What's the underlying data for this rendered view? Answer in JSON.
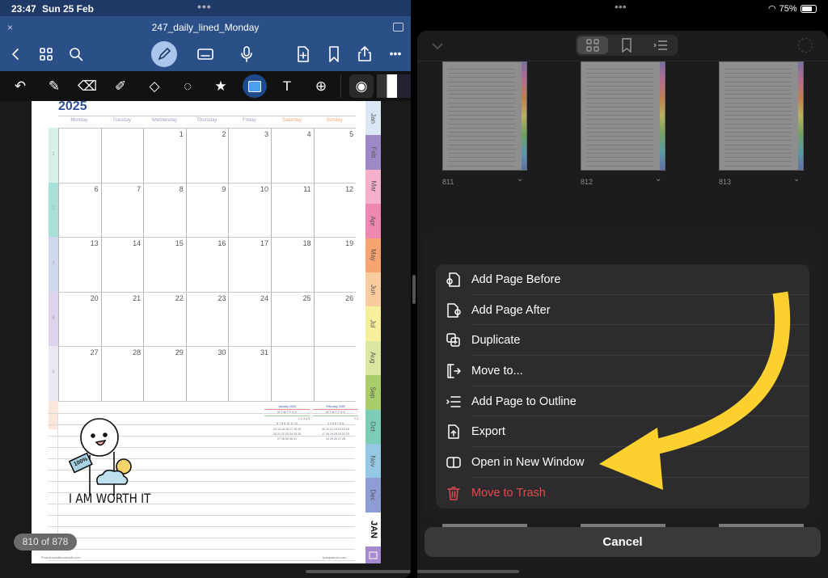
{
  "status": {
    "time": "23:47",
    "date": "Sun 25 Feb",
    "battery": "75%"
  },
  "document": {
    "title": "247_daily_lined_Monday",
    "page_counter": "810 of 878"
  },
  "toolbar": {
    "icons": [
      "back-icon",
      "thumbnails-icon",
      "search-icon",
      "pen-mode-icon",
      "keyboard-icon",
      "microphone-icon",
      "add-page-icon",
      "bookmark-icon",
      "share-icon",
      "more-icon"
    ]
  },
  "tools": {
    "icons": [
      "undo-icon",
      "pen-icon",
      "eraser-icon",
      "highlighter-icon",
      "shapes-icon",
      "lasso-icon",
      "sticker-icon",
      "image-icon",
      "text-icon",
      "zoom-window-icon",
      "camera-icon"
    ],
    "active": "image-icon"
  },
  "calendar": {
    "year": "2025",
    "days": [
      "Monday",
      "Tuesday",
      "Wednesday",
      "Thursday",
      "Friday",
      "Saturday",
      "Sunday"
    ],
    "weekend_color": "#f0a878",
    "week_numbers": [
      "1",
      "2",
      "3",
      "4",
      "5"
    ],
    "weeks": [
      [
        "",
        "",
        "1",
        "2",
        "3",
        "4",
        "5"
      ],
      [
        "6",
        "7",
        "8",
        "9",
        "10",
        "11",
        "12"
      ],
      [
        "13",
        "14",
        "15",
        "16",
        "17",
        "18",
        "19"
      ],
      [
        "20",
        "21",
        "22",
        "23",
        "24",
        "25",
        "26"
      ],
      [
        "27",
        "28",
        "29",
        "30",
        "31",
        "",
        ""
      ]
    ],
    "week_colors": [
      "#d6f0ea",
      "#a8dfd6",
      "#d0d8ef",
      "#ddd3ec",
      "#ece8f3",
      "#fbe6da"
    ]
  },
  "mini_calendars": [
    {
      "title": "January 2025",
      "head": [
        "M",
        "T",
        "W",
        "T",
        "F",
        "S",
        "S"
      ],
      "rows": [
        "1 2 3 4 5",
        "6 7 8 9 10 11 12",
        "13 14 15 16 17 18 19",
        "20 21 22 23 24 25 26",
        "27 28 29 30 31"
      ]
    },
    {
      "title": "February 2025",
      "head": [
        "M",
        "T",
        "W",
        "T",
        "F",
        "S",
        "S"
      ],
      "rows": [
        "1 2",
        "3 4 5 6 7 8 9",
        "10 11 12 13 14 15 16",
        "17 18 19 20 21 22 23",
        "24 25 26 27 28"
      ]
    }
  ],
  "sticker": {
    "text": "I AM WORTH IT",
    "badge": "100%"
  },
  "footer": {
    "left": "Photoinspirationalstyle.com",
    "right": "Ipadplanner.com"
  },
  "tabs": [
    {
      "label": "Jan",
      "color": "#dce7f6"
    },
    {
      "label": "Feb",
      "color": "#9d89c6"
    },
    {
      "label": "Mar",
      "color": "#f5b0cc"
    },
    {
      "label": "Apr",
      "color": "#ef88b0"
    },
    {
      "label": "May",
      "color": "#f7a470"
    },
    {
      "label": "Jun",
      "color": "#f9cb9e"
    },
    {
      "label": "Jul",
      "color": "#f8ef9c"
    },
    {
      "label": "Aug",
      "color": "#dbe6a0"
    },
    {
      "label": "Sep",
      "color": "#a9cd6b"
    },
    {
      "label": "Oct",
      "color": "#7ccdb5"
    },
    {
      "label": "Nov",
      "color": "#95c8e3"
    },
    {
      "label": "Dec",
      "color": "#8f9dd5"
    },
    {
      "label": "JAN",
      "color": "#ffffff"
    }
  ],
  "thumbnails": [
    {
      "label": "811"
    },
    {
      "label": "812"
    },
    {
      "label": "813"
    }
  ],
  "menu": [
    {
      "label": "Add Page Before",
      "icon": "add-page-before-icon"
    },
    {
      "label": "Add Page After",
      "icon": "add-page-after-icon"
    },
    {
      "label": "Duplicate",
      "icon": "duplicate-icon"
    },
    {
      "label": "Move to...",
      "icon": "move-to-icon"
    },
    {
      "label": "Add Page to Outline",
      "icon": "outline-icon"
    },
    {
      "label": "Export",
      "icon": "export-icon"
    },
    {
      "label": "Open in New Window",
      "icon": "new-window-icon"
    },
    {
      "label": "Move to Trash",
      "icon": "trash-icon",
      "destructive": true
    }
  ],
  "cancel_label": "Cancel",
  "colors": {
    "accent_blue": "#2a5087",
    "destructive": "#e5484d",
    "arrow": "#fcd02f"
  }
}
